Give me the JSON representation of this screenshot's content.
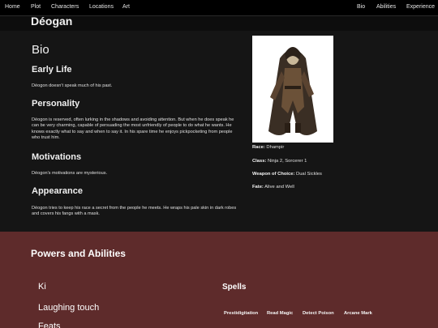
{
  "nav": {
    "left": [
      "Home",
      "Plot",
      "Characters",
      "Locations",
      "Art"
    ],
    "right": [
      "Bio",
      "Abilities",
      "Experience"
    ]
  },
  "page_title": "Déogan",
  "bio": {
    "heading": "Bio",
    "sections": [
      {
        "title": "Early Life",
        "text": "Déogon doesn't speak much of his past."
      },
      {
        "title": "Personality",
        "text": "Déogon is reserved, often lurking in the shadows and avoiding attention. But when he does speak he can be very charming, capable of persuading the most unfriendly of people to do what he wants. He knows exactly what to say and when to say it. In his spare time he enjoys pickpocketing from people who trust him."
      },
      {
        "title": "Motivations",
        "text": "Déogon's motivations are mysterious."
      },
      {
        "title": "Appearance",
        "text": "Déogon tries to keep his race a secret from the people he meets. He wraps his pale skin in dark robes and covers his fangs with a mask."
      }
    ]
  },
  "stats": [
    {
      "label": "Race:",
      "value": "Dhampir"
    },
    {
      "label": "Class:",
      "value": "Ninja 2, Sorcerer 1"
    },
    {
      "label": "Weapon of Choice:",
      "value": "Dual Sickles"
    },
    {
      "label": "Fate:",
      "value": "Alive and Well"
    }
  ],
  "powers": {
    "title": "Powers and Abilities",
    "items": [
      "Ki",
      "Laughing touch",
      "Feats"
    ],
    "spells_title": "Spells",
    "spells": [
      "Prestidigitation",
      "Read Magic",
      "Detect Poison",
      "Arcane Mark"
    ]
  },
  "colors": {
    "powers_bg": "#5e2b2b",
    "page_bg": "#151515",
    "nav_bg": "#000000"
  }
}
